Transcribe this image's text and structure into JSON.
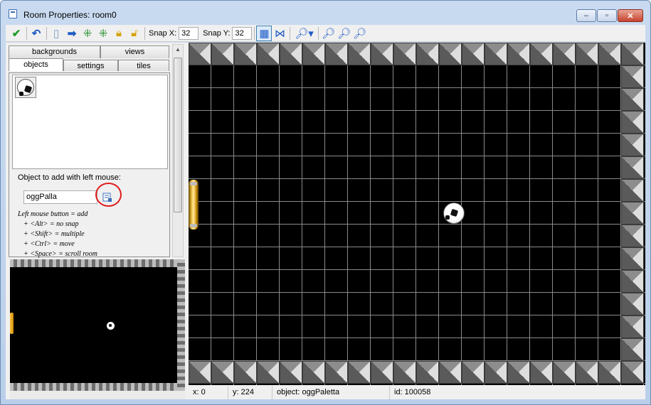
{
  "window": {
    "title": "Room Properties: room0",
    "minimize": "–",
    "maximize": "▫",
    "close": "✕"
  },
  "toolbar": {
    "snap_x_label": "Snap X:",
    "snap_x_value": "32",
    "snap_y_label": "Snap Y:",
    "snap_y_value": "32",
    "icons": [
      "ok-icon",
      "undo-icon",
      "new-icon",
      "shift-icon",
      "grid-move-icon",
      "grid-arrange-icon",
      "lock-icon",
      "unlock-icon",
      "grid-toggle-icon",
      "isometric-icon",
      "zoom-dropdown-icon",
      "zoom-out-icon",
      "zoom-reset-icon",
      "zoom-in-icon"
    ]
  },
  "tabs": {
    "backgrounds": "backgrounds",
    "views": "views",
    "objects": "objects",
    "settings": "settings",
    "tiles": "tiles"
  },
  "objects_panel": {
    "add_label": "Object to add with left mouse:",
    "selected_object": "oggPalla",
    "help": [
      "Left mouse button = add",
      "+ <Alt> = no snap",
      "+ <Shift> = multiple",
      "+ <Ctrl> = move",
      "+ <Space> = scroll room"
    ]
  },
  "status": {
    "x": "x: 0",
    "y": "y: 224",
    "object": "object: oggPaletta",
    "id": "id: 100058"
  },
  "colors": {
    "title_bar": "#c9daf0",
    "room_background": "#000000",
    "highlight_circle": "#e01b1b"
  }
}
